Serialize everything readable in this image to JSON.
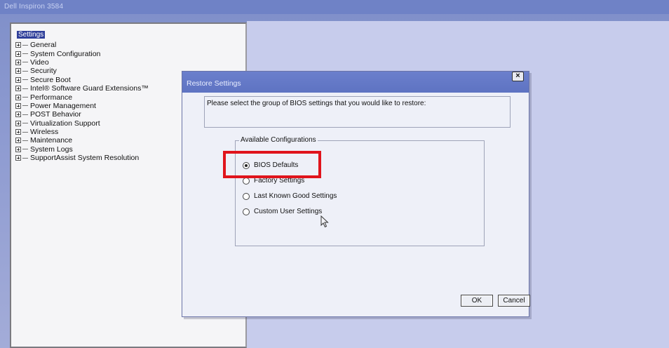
{
  "app": {
    "title": "Dell Inspiron 3584"
  },
  "tree": {
    "root": "Settings",
    "items": [
      {
        "label": "General"
      },
      {
        "label": "System Configuration"
      },
      {
        "label": "Video"
      },
      {
        "label": "Security"
      },
      {
        "label": "Secure Boot"
      },
      {
        "label": "Intel® Software Guard Extensions™"
      },
      {
        "label": "Performance"
      },
      {
        "label": "Power Management"
      },
      {
        "label": "POST Behavior"
      },
      {
        "label": "Virtualization Support"
      },
      {
        "label": "Wireless"
      },
      {
        "label": "Maintenance"
      },
      {
        "label": "System Logs"
      },
      {
        "label": "SupportAssist System Resolution"
      }
    ]
  },
  "dialog": {
    "title": "Restore Settings",
    "close_label": "×",
    "prompt": "Please select the group of BIOS settings that you would like to restore:",
    "group_label": "Available Configurations",
    "options": [
      {
        "label": "BIOS Defaults",
        "selected": true
      },
      {
        "label": "Factory Settings",
        "selected": false
      },
      {
        "label": "Last Known Good Settings",
        "selected": false
      },
      {
        "label": "Custom User Settings",
        "selected": false
      }
    ],
    "ok_label": "OK",
    "cancel_label": "Cancel"
  },
  "colors": {
    "background": "#8a97cc",
    "title_bar": "#6b7fcc",
    "highlight": "#e0141c",
    "selected_tree": "#2f3f9a"
  }
}
